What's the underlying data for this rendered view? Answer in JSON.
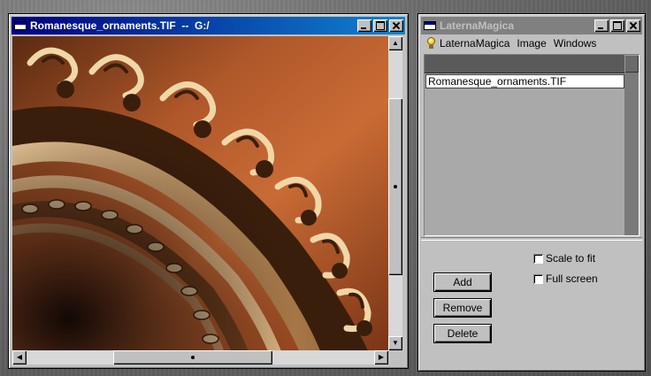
{
  "image_window": {
    "title": "Romanesque_ornaments.TIF  --  G:/",
    "state": "active",
    "vscroll_position": 0.5,
    "hscroll_position": 0.5
  },
  "laterna_window": {
    "title": "LaternaMagica",
    "state": "inactive",
    "menu": [
      "LaternaMagica",
      "Image",
      "Windows"
    ],
    "file_list": [
      "Romanesque_ornaments.TIF"
    ],
    "buttons": {
      "add": "Add",
      "remove": "Remove",
      "delete": "Delete"
    },
    "options": {
      "scale_to_fit": {
        "label": "Scale to fit",
        "checked": false
      },
      "full_screen": {
        "label": "Full screen",
        "checked": false
      }
    }
  },
  "colors": {
    "active_title": "#000080",
    "inactive_title": "#808080",
    "window_face": "#c0c0c0"
  }
}
